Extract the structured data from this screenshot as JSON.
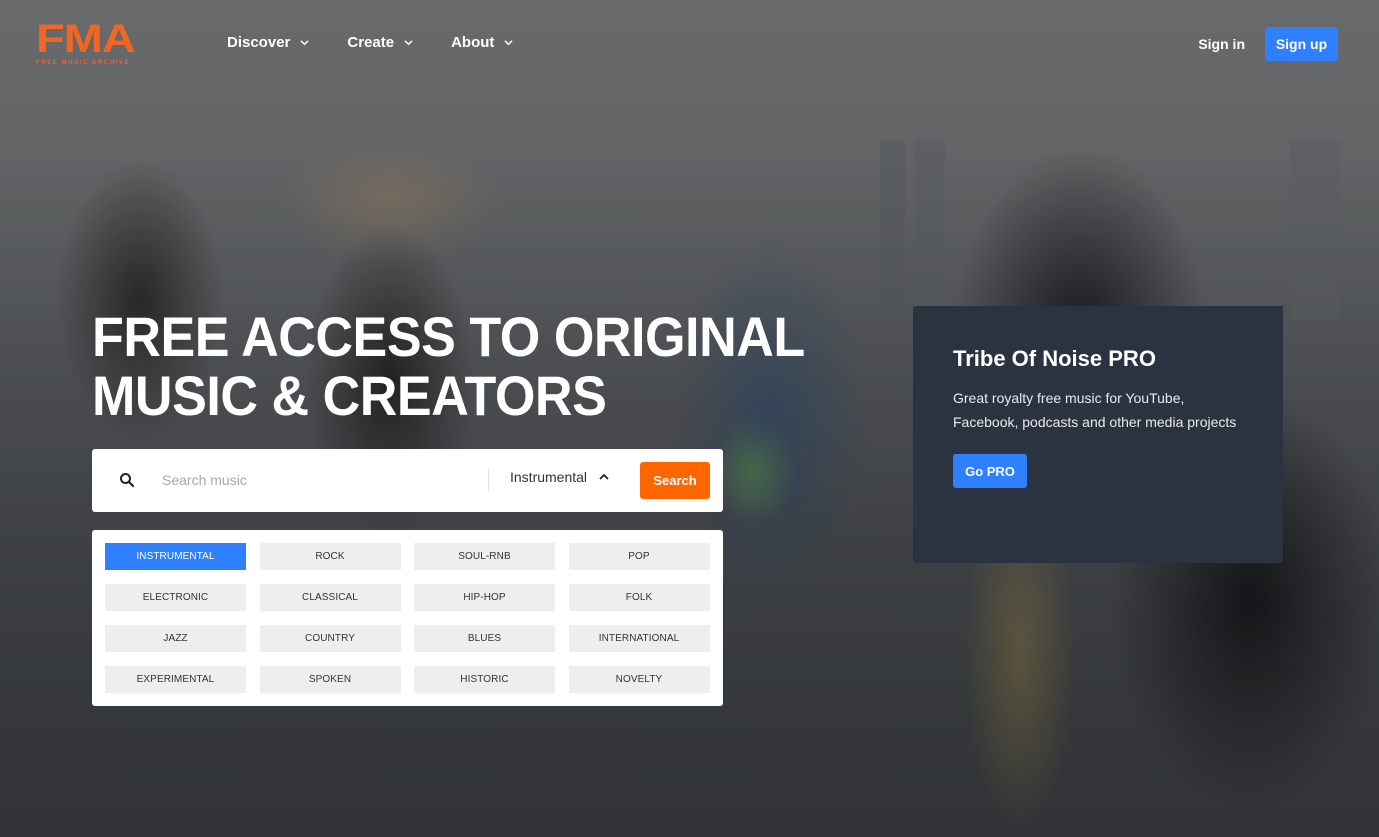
{
  "brand": {
    "logo_text": "FMA",
    "logo_subtitle": "Free Music Archive",
    "accent_color": "#f26522"
  },
  "nav": {
    "items": [
      {
        "label": "Discover",
        "icon": "chevron-down-icon"
      },
      {
        "label": "Create",
        "icon": "chevron-down-icon"
      },
      {
        "label": "About",
        "icon": "chevron-down-icon"
      }
    ],
    "sign_in": "Sign in",
    "sign_up": "Sign up"
  },
  "hero": {
    "title_line1": "FREE ACCESS TO ORIGINAL",
    "title_line2": "MUSIC & CREATORS"
  },
  "search": {
    "icon": "search-icon",
    "placeholder": "Search music",
    "value": "",
    "genre_selected": "Instrumental",
    "genre_icon": "chevron-up-icon",
    "button_label": "Search",
    "button_color": "#ff6600"
  },
  "genres": {
    "active": "INSTRUMENTAL",
    "items": [
      "INSTRUMENTAL",
      "ROCK",
      "SOUL-RNB",
      "POP",
      "ELECTRONIC",
      "CLASSICAL",
      "HIP-HOP",
      "FOLK",
      "JAZZ",
      "COUNTRY",
      "BLUES",
      "INTERNATIONAL",
      "EXPERIMENTAL",
      "SPOKEN",
      "HISTORIC",
      "NOVELTY"
    ]
  },
  "pro_card": {
    "title": "Tribe Of Noise PRO",
    "description": "Great royalty free music for YouTube, Facebook, podcasts and other media projects",
    "button_label": "Go PRO",
    "button_color": "#2f80ff"
  }
}
